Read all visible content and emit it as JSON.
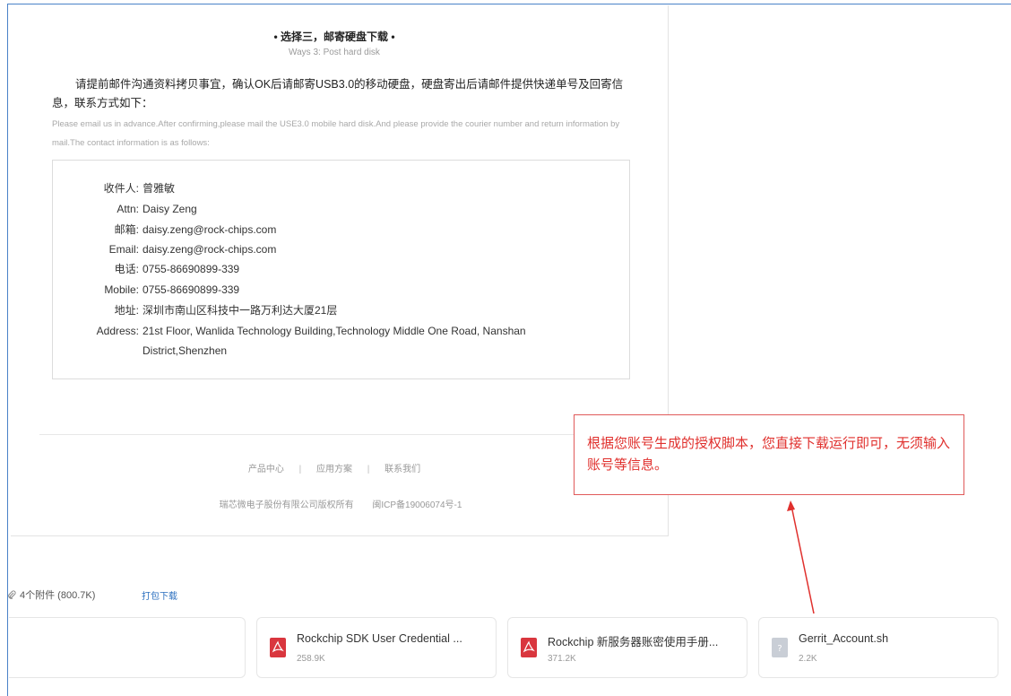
{
  "section": {
    "title": "• 选择三，邮寄硬盘下载 •",
    "subtitle": "Ways 3: Post hard disk",
    "para_zh": "请提前邮件沟通资料拷贝事宜，确认OK后请邮寄USB3.0的移动硬盘，硬盘寄出后请邮件提供快递单号及回寄信息，联系方式如下：",
    "para_en": "Please email us in advance.After confirming,please mail the USE3.0 mobile hard disk.And please provide the courier number and return information by mail.The contact information is as follows:"
  },
  "contact": [
    {
      "label": "收件人:",
      "value": "曾雅敏"
    },
    {
      "label": "Attn:",
      "value": "Daisy Zeng"
    },
    {
      "label": "邮箱:",
      "value": "daisy.zeng@rock-chips.com"
    },
    {
      "label": "Email:",
      "value": "daisy.zeng@rock-chips.com"
    },
    {
      "label": "电话:",
      "value": "0755-86690899-339"
    },
    {
      "label": "Mobile:",
      "value": "0755-86690899-339"
    },
    {
      "label": "地址:",
      "value": "深圳市南山区科技中一路万利达大厦21层"
    },
    {
      "label": "Address:",
      "value": "21st Floor, Wanlida Technology Building,Technology Middle One Road, Nanshan District,Shenzhen"
    }
  ],
  "footer": {
    "links": [
      "产品中心",
      "应用方案",
      "联系我们"
    ],
    "separator": "|",
    "copyright": "瑞芯微电子股份有限公司版权所有",
    "icp": "闽ICP备19006074号-1"
  },
  "annotation": {
    "text": "根据您账号生成的授权脚本，您直接下载运行即可，无须输入账号等信息。",
    "color": "#e0302d"
  },
  "attachments": {
    "summary": "4个附件 (800.7K)",
    "download_all": "打包下载",
    "files": [
      {
        "name": "Rockchip SDK User Credential ...",
        "size": "258.9K",
        "icon": "pdf-icon"
      },
      {
        "name": "Rockchip 新服务器账密使用手册...",
        "size": "371.2K",
        "icon": "pdf-icon"
      },
      {
        "name": "Gerrit_Account.sh",
        "size": "2.2K",
        "icon": "file-icon"
      }
    ]
  },
  "colors": {
    "pdf_red": "#d9363e",
    "link_blue": "#2b6fbf"
  }
}
